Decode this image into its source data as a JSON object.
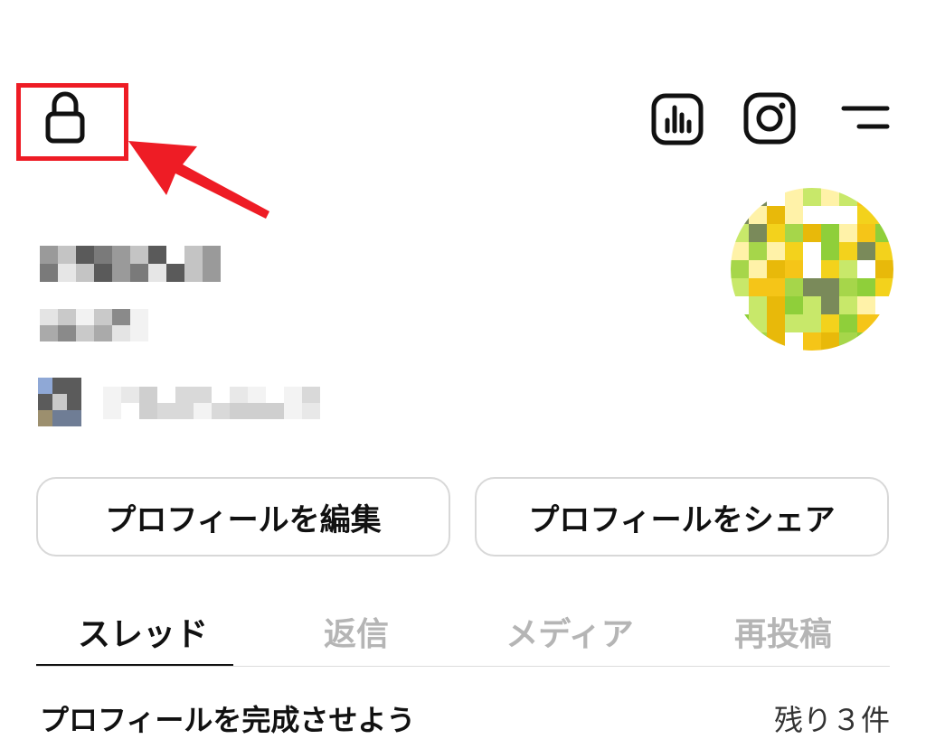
{
  "header": {
    "lock_icon": "lock-icon",
    "icons": [
      "insights-icon",
      "instagram-icon",
      "menu-icon"
    ]
  },
  "annotation": {
    "highlight_color": "#ee1c25"
  },
  "profile": {
    "name_redacted": true,
    "handle_redacted": true,
    "link_redacted": true
  },
  "buttons": {
    "edit_label": "プロフィールを編集",
    "share_label": "プロフィールをシェア"
  },
  "tabs": [
    {
      "label": "スレッド",
      "active": true
    },
    {
      "label": "返信",
      "active": false
    },
    {
      "label": "メディア",
      "active": false
    },
    {
      "label": "再投稿",
      "active": false
    }
  ],
  "complete_profile": {
    "title": "プロフィールを完成させよう",
    "remaining": "残り３件"
  }
}
